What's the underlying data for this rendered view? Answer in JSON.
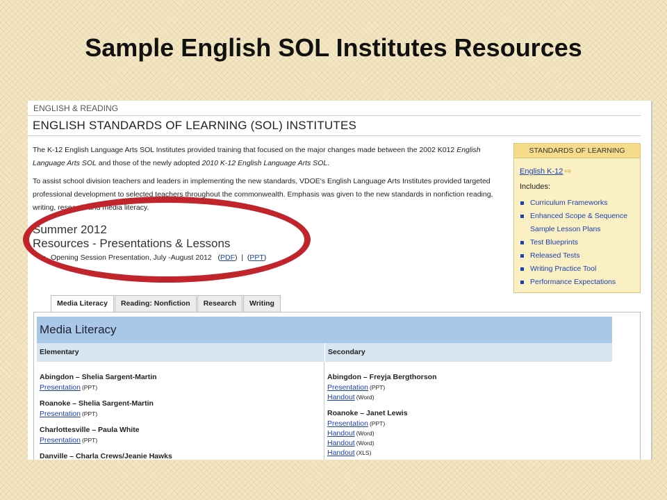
{
  "slide_title": "Sample English SOL Institutes Resources",
  "breadcrumb": "ENGLISH & READING",
  "page_heading": "ENGLISH STANDARDS OF LEARNING (SOL) INSTITUTES",
  "intro": {
    "p1_a": "The K-12 English Language Arts SOL Institutes provided training that focused on the major changes made between the 2002 K012 ",
    "p1_em1": "English Language Arts SOL",
    "p1_b": " and those of the newly adopted ",
    "p1_em2": "2010 K-12 English Language Arts SOL",
    "p1_c": ".",
    "p2": "To assist school division teachers and leaders in implementing the new standards, VDOE's English Language Arts Institutes provided targeted professional development to selected teachers throughout the commonwealth. Emphasis was given to the new standards in nonfiction reading, writing, research and media literacy."
  },
  "season": "Summer 2012",
  "resources_title": "Resources - Presentations & Lessons",
  "opening": {
    "text": "Opening Session Presentation, July -August 2012",
    "pdf": "PDF",
    "ppt": "PPT"
  },
  "sidebar": {
    "header": "STANDARDS OF LEARNING",
    "link": "English K-12",
    "includes": "Includes:",
    "items": [
      "Curriculum Frameworks",
      "Enhanced Scope & Sequence",
      "Sample Lesson Plans",
      "Test Blueprints",
      "Released Tests",
      "Writing Practice Tool",
      "Performance Expectations"
    ]
  },
  "tabs": [
    "Media Literacy",
    "Reading: Nonfiction",
    "Research",
    "Writing"
  ],
  "panel": {
    "title": "Media Literacy",
    "col_elementary": "Elementary",
    "col_secondary": "Secondary",
    "elementary": [
      {
        "name": "Abingdon – Shelia Sargent-Martin",
        "resources": [
          {
            "label": "Presentation",
            "format": "(PPT)"
          }
        ]
      },
      {
        "name": "Roanoke – Shelia Sargent-Martin",
        "resources": [
          {
            "label": "Presentation",
            "format": "(PPT)"
          }
        ]
      },
      {
        "name": "Charlottesville – Paula White",
        "resources": [
          {
            "label": "Presentation",
            "format": "(PPT)"
          }
        ]
      },
      {
        "name": "Danville – Charla Crews/Jeanie Hawks",
        "resources": []
      }
    ],
    "secondary": [
      {
        "name": "Abingdon – Freyja Bergthorson",
        "resources": [
          {
            "label": "Presentation",
            "format": "(PPT)"
          },
          {
            "label": "Handout",
            "format": "(Word)"
          }
        ]
      },
      {
        "name": "Roanoke – Janet Lewis",
        "resources": [
          {
            "label": "Presentation",
            "format": "(PPT)"
          },
          {
            "label": "Handout",
            "format": "(Word)"
          },
          {
            "label": "Handout",
            "format": "(Word)"
          },
          {
            "label": "Handout",
            "format": "(XLS)"
          }
        ]
      }
    ]
  },
  "colors": {
    "highlight_ellipse": "#c1242b",
    "link": "#1a3fb0",
    "panel_title_bg": "#a9c8e8"
  }
}
